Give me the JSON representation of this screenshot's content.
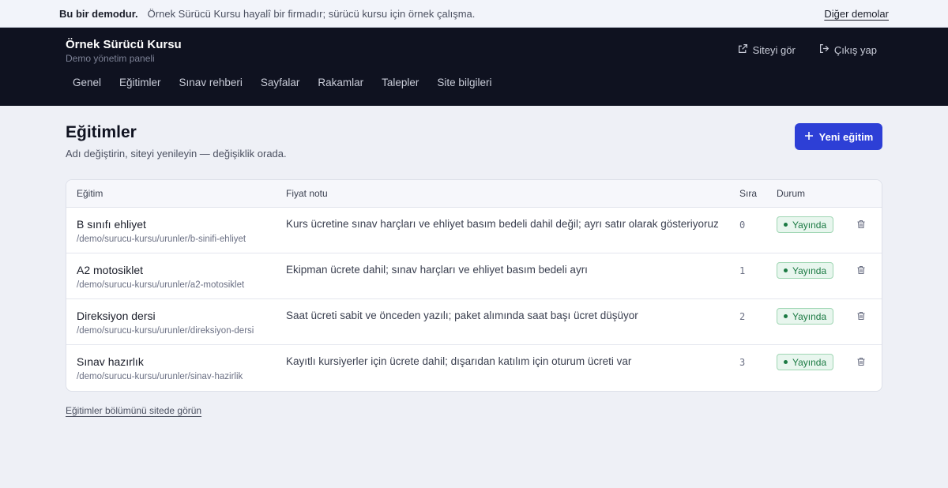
{
  "demo_bar": {
    "label": "Bu bir demodur.",
    "text": "Örnek Sürücü Kursu hayalî bir firmadır; sürücü kursu için örnek çalışma.",
    "link": "Diğer demolar"
  },
  "header": {
    "title": "Örnek Sürücü Kursu",
    "subtitle": "Demo yönetim paneli",
    "view_site": "Siteyi gör",
    "logout": "Çıkış yap",
    "nav": [
      "Genel",
      "Eğitimler",
      "Sınav rehberi",
      "Sayfalar",
      "Rakamlar",
      "Talepler",
      "Site bilgileri"
    ]
  },
  "page": {
    "title": "Eğitimler",
    "subtitle": "Adı değiştirin, siteyi yenileyin — değişiklik orada.",
    "new_button": "Yeni eğitim"
  },
  "table": {
    "headers": {
      "name": "Eğitim",
      "note": "Fiyat notu",
      "order": "Sıra",
      "status": "Durum"
    },
    "rows": [
      {
        "name": "B sınıfı ehliyet",
        "path": "/demo/surucu-kursu/urunler/b-sinifi-ehliyet",
        "note": "Kurs ücretine sınav harçları ve ehliyet basım bedeli dahil değil; ayrı satır olarak gösteriyoruz",
        "order": "0",
        "status": "Yayında"
      },
      {
        "name": "A2 motosiklet",
        "path": "/demo/surucu-kursu/urunler/a2-motosiklet",
        "note": "Ekipman ücrete dahil; sınav harçları ve ehliyet basım bedeli ayrı",
        "order": "1",
        "status": "Yayında"
      },
      {
        "name": "Direksiyon dersi",
        "path": "/demo/surucu-kursu/urunler/direksiyon-dersi",
        "note": "Saat ücreti sabit ve önceden yazılı; paket alımında saat başı ücret düşüyor",
        "order": "2",
        "status": "Yayında"
      },
      {
        "name": "Sınav hazırlık",
        "path": "/demo/surucu-kursu/urunler/sinav-hazirlik",
        "note": "Kayıtlı kursiyerler için ücrete dahil; dışarıdan katılım için oturum ücreti var",
        "order": "3",
        "status": "Yayında"
      }
    ]
  },
  "footer_link": "Eğitimler bölümünü sitede görün",
  "colors": {
    "accent": "#2d3fd6",
    "nav_bg": "#0f1220",
    "status_green": "#1b7a43"
  },
  "icons": {
    "view_site": "external-link-icon",
    "logout": "logout-icon",
    "new": "plus-icon",
    "delete": "trash-icon"
  }
}
